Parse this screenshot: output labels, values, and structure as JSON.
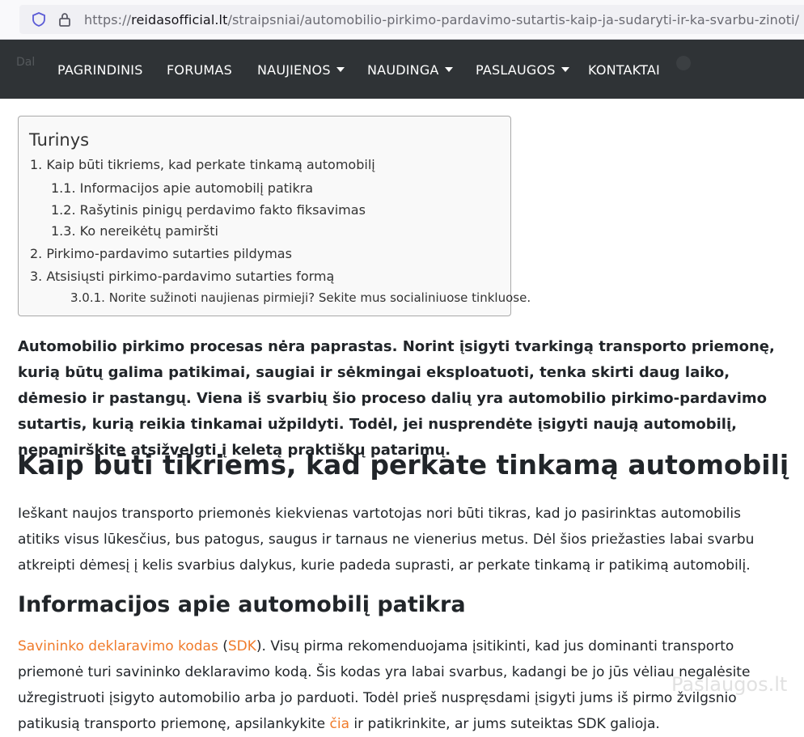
{
  "browser": {
    "url_prefix": "https://",
    "url_domain": "reidasofficial.lt",
    "url_path": "/straipsniai/automobilio-pirkimo-pardavimo-sutartis-kaip-ja-sudaryti-ir-ka-svarbu-zinoti/"
  },
  "nav": {
    "items": [
      {
        "label": "PAGRINDINIS"
      },
      {
        "label": "FORUMAS"
      },
      {
        "label": "NAUJIENOS"
      },
      {
        "label": "NAUDINGA"
      },
      {
        "label": "PASLAUGOS"
      },
      {
        "label": "KONTAKTAI"
      }
    ],
    "ghost_left": "Dal"
  },
  "toc": {
    "title": "Turinys",
    "items": [
      {
        "label": "1. Kaip būti tikriems, kad perkate tinkamą automobilį"
      },
      {
        "label": "1.1. Informacijos apie automobilį patikra"
      },
      {
        "label": "1.2. Rašytinis pinigų perdavimo fakto fiksavimas"
      },
      {
        "label": "1.3. Ko nereikėtų pamiršti"
      },
      {
        "label": "2. Pirkimo-pardavimo sutarties pildymas"
      },
      {
        "label": "3. Atsisiųsti pirkimo-pardavimo sutarties formą"
      },
      {
        "label": "3.0.1. Norite sužinoti naujienas pirmieji? Sekite mus socialiniuose tinkluose."
      }
    ]
  },
  "article": {
    "intro": "Automobilio pirkimo procesas nėra paprastas. Norint įsigyti tvarkingą transporto priemonę, kurią būtų galima patikimai, saugiai ir sėkmingai eksploatuoti, tenka skirti daug laiko, dėmesio ir pastangų. Viena iš svarbių šio proceso dalių yra automobilio pirkimo-pardavimo sutartis, kurią reikia tinkamai užpildyti. Todėl, jei nusprendėte įsigyti naują automobilį, nepamirškite atsižvelgti į keletą praktiškų patarimų.",
    "h1": "Kaip būti tikriems, kad perkate tinkamą automobilį",
    "p1": "Ieškant naujos transporto priemonės kiekvienas vartotojas nori būti tikras, kad jo pasirinktas automobilis atitiks visus lūkesčius, bus patogus, saugus ir tarnaus ne vienerius metus. Dėl šios priežasties labai svarbu atkreipti dėmesį į kelis svarbius dalykus, kurie padeda suprasti, ar perkate tinkamą ir patikimą automobilį.",
    "h2": "Informacijos apie automobilį patikra",
    "p2_link1": "Savininko deklaravimo kodas",
    "p2_open": " (",
    "p2_link2": "SDK",
    "p2_text": "). Visų pirma rekomenduojama įsitikinti, kad jus dominanti transporto priemonė turi savininko deklaravimo kodą. Šis kodas yra labai svarbus, kadangi be jo jūs vėliau negalėsite užregistruoti įsigyto automobilio arba jo parduoti. Todėl prieš nuspręsdami įsigyti jums iš pirmo žvilgsnio patikusią transporto priemonę, apsilankykite ",
    "p2_link3": "čia",
    "p2_tail": " ir patikrinkite, ar jums suteiktas SDK galioja."
  },
  "watermark": "Paslaugos.lt"
}
